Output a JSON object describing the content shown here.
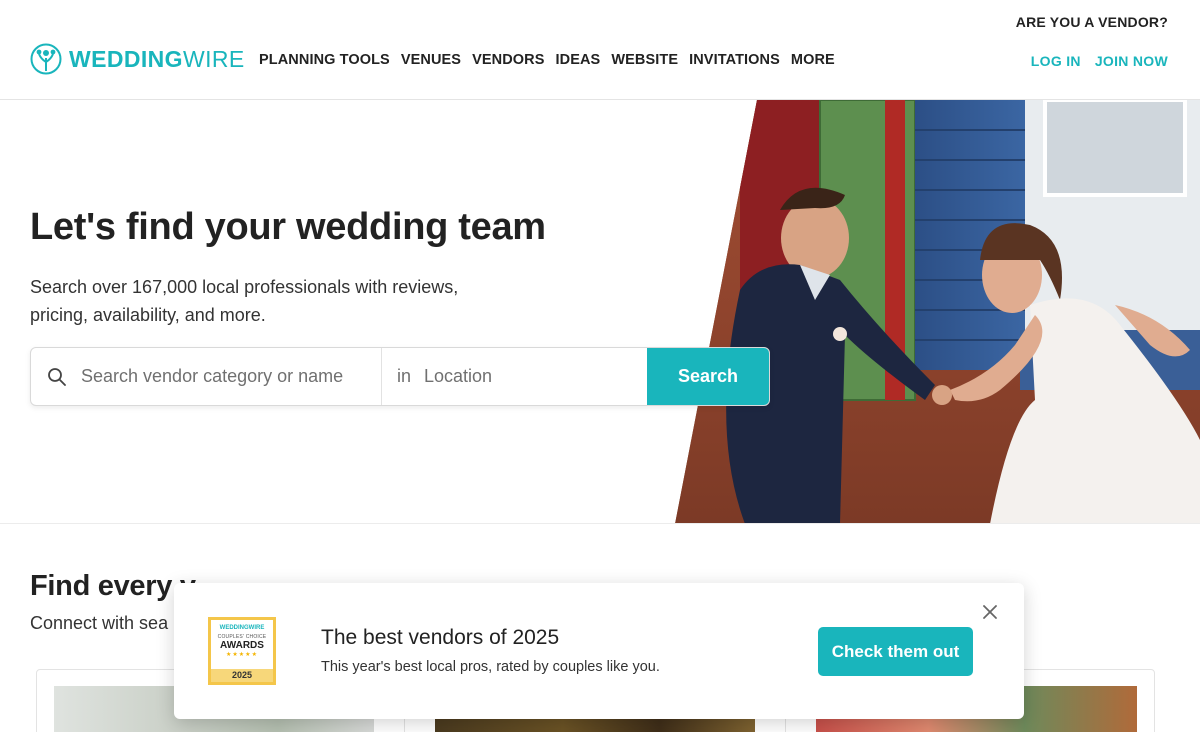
{
  "header": {
    "vendor_link": "ARE YOU A VENDOR?",
    "logo": {
      "bold": "WEDDING",
      "light": "WIRE"
    },
    "nav": [
      "PLANNING TOOLS",
      "VENUES",
      "VENDORS",
      "IDEAS",
      "WEBSITE",
      "INVITATIONS",
      "MORE"
    ],
    "login": "LOG IN",
    "join": "JOIN NOW"
  },
  "hero": {
    "title": "Let's find your wedding team",
    "subtitle": "Search over 167,000 local professionals with reviews, pricing, availability, and more.",
    "search": {
      "category_placeholder": "Search vendor category or name",
      "in_label": "in",
      "location_placeholder": "Location",
      "button": "Search"
    }
  },
  "section": {
    "title": "Find every v",
    "subtitle": "Connect with sea"
  },
  "popup": {
    "badge": {
      "brand": "WEDDINGWIRE",
      "line1": "COUPLES' CHOICE",
      "line2": "AWARDS",
      "stars": "★★★★★",
      "year": "2025"
    },
    "title": "The best vendors of 2025",
    "subtitle": "This year's best local pros, rated by couples like you.",
    "button": "Check them out"
  },
  "colors": {
    "accent": "#19b5bc",
    "badge_gold": "#f4c64a"
  },
  "icons": [
    "weddingwire-logo-icon",
    "search-icon",
    "close-icon"
  ]
}
